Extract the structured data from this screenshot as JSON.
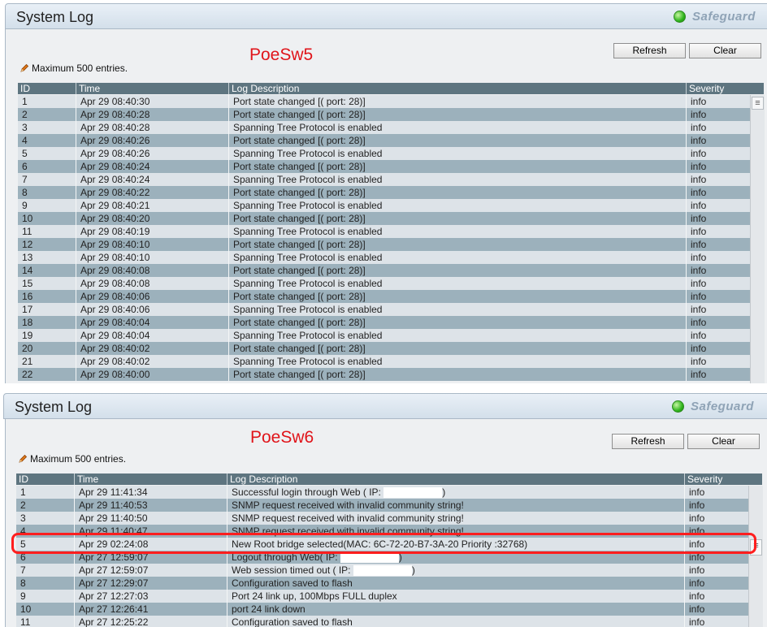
{
  "colors": {
    "header_bg": "#5e7580",
    "row_light": "#dde3e8",
    "row_dark": "#9cb1bc",
    "annotation_red": "#e0141a",
    "status_green": "#2fb51c"
  },
  "panels": [
    {
      "title": "System Log",
      "safeguard_label": "Safeguard",
      "switch_label": "PoeSw5",
      "max_note": "Maximum 500 entries.",
      "refresh_label": "Refresh",
      "clear_label": "Clear",
      "columns": [
        "ID",
        "Time",
        "Log Description",
        "Severity"
      ],
      "rows": [
        {
          "id": "1",
          "time": "Apr 29 08:40:30",
          "desc": "Port state changed [( port: 28)]",
          "severity": "info"
        },
        {
          "id": "2",
          "time": "Apr 29 08:40:28",
          "desc": "Port state changed [( port: 28)]",
          "severity": "info"
        },
        {
          "id": "3",
          "time": "Apr 29 08:40:28",
          "desc": "Spanning Tree Protocol is enabled",
          "severity": "info"
        },
        {
          "id": "4",
          "time": "Apr 29 08:40:26",
          "desc": "Port state changed [( port: 28)]",
          "severity": "info"
        },
        {
          "id": "5",
          "time": "Apr 29 08:40:26",
          "desc": "Spanning Tree Protocol is enabled",
          "severity": "info"
        },
        {
          "id": "6",
          "time": "Apr 29 08:40:24",
          "desc": "Port state changed [( port: 28)]",
          "severity": "info"
        },
        {
          "id": "7",
          "time": "Apr 29 08:40:24",
          "desc": "Spanning Tree Protocol is enabled",
          "severity": "info"
        },
        {
          "id": "8",
          "time": "Apr 29 08:40:22",
          "desc": "Port state changed [( port: 28)]",
          "severity": "info"
        },
        {
          "id": "9",
          "time": "Apr 29 08:40:21",
          "desc": "Spanning Tree Protocol is enabled",
          "severity": "info"
        },
        {
          "id": "10",
          "time": "Apr 29 08:40:20",
          "desc": "Port state changed [( port: 28)]",
          "severity": "info"
        },
        {
          "id": "11",
          "time": "Apr 29 08:40:19",
          "desc": "Spanning Tree Protocol is enabled",
          "severity": "info"
        },
        {
          "id": "12",
          "time": "Apr 29 08:40:10",
          "desc": "Port state changed [( port: 28)]",
          "severity": "info"
        },
        {
          "id": "13",
          "time": "Apr 29 08:40:10",
          "desc": "Spanning Tree Protocol is enabled",
          "severity": "info"
        },
        {
          "id": "14",
          "time": "Apr 29 08:40:08",
          "desc": "Port state changed [( port: 28)]",
          "severity": "info"
        },
        {
          "id": "15",
          "time": "Apr 29 08:40:08",
          "desc": "Spanning Tree Protocol is enabled",
          "severity": "info"
        },
        {
          "id": "16",
          "time": "Apr 29 08:40:06",
          "desc": "Port state changed [( port: 28)]",
          "severity": "info"
        },
        {
          "id": "17",
          "time": "Apr 29 08:40:06",
          "desc": "Spanning Tree Protocol is enabled",
          "severity": "info"
        },
        {
          "id": "18",
          "time": "Apr 29 08:40:04",
          "desc": "Port state changed [( port: 28)]",
          "severity": "info"
        },
        {
          "id": "19",
          "time": "Apr 29 08:40:04",
          "desc": "Spanning Tree Protocol is enabled",
          "severity": "info"
        },
        {
          "id": "20",
          "time": "Apr 29 08:40:02",
          "desc": "Port state changed [( port: 28)]",
          "severity": "info"
        },
        {
          "id": "21",
          "time": "Apr 29 08:40:02",
          "desc": "Spanning Tree Protocol is enabled",
          "severity": "info"
        },
        {
          "id": "22",
          "time": "Apr 29 08:40:00",
          "desc": "Port state changed [( port: 28)]",
          "severity": "info"
        }
      ]
    },
    {
      "title": "System Log",
      "safeguard_label": "Safeguard",
      "switch_label": "PoeSw6",
      "max_note": "Maximum 500 entries.",
      "refresh_label": "Refresh",
      "clear_label": "Clear",
      "columns": [
        "ID",
        "Time",
        "Log Description",
        "Severity"
      ],
      "rows": [
        {
          "id": "1",
          "time": "Apr 29 11:41:34",
          "desc": "Successful login through Web ( IP:",
          "desc_tail": ")",
          "redacted": true,
          "severity": "info"
        },
        {
          "id": "2",
          "time": "Apr 29 11:40:53",
          "desc": "SNMP request received with invalid community string!",
          "severity": "info"
        },
        {
          "id": "3",
          "time": "Apr 29 11:40:50",
          "desc": "SNMP request received with invalid community string!",
          "severity": "info"
        },
        {
          "id": "4",
          "time": "Apr 29 11:40:47",
          "desc": "SNMP request received with invalid community string!",
          "severity": "info"
        },
        {
          "id": "5",
          "time": "Apr 29 02:24:08",
          "desc": "New Root bridge selected(MAC: 6C-72-20-B7-3A-20 Priority :32768)",
          "severity": "info"
        },
        {
          "id": "6",
          "time": "Apr 27 12:59:07",
          "desc": "Logout through Web( IP:",
          "desc_tail": ")",
          "redacted": true,
          "severity": "info"
        },
        {
          "id": "7",
          "time": "Apr 27 12:59:07",
          "desc": "Web session timed out ( IP:",
          "desc_tail": ")",
          "redacted": true,
          "severity": "info"
        },
        {
          "id": "8",
          "time": "Apr 27 12:29:07",
          "desc": "Configuration saved to flash",
          "severity": "info"
        },
        {
          "id": "9",
          "time": "Apr 27 12:27:03",
          "desc": "Port 24 link up, 100Mbps FULL duplex",
          "severity": "info"
        },
        {
          "id": "10",
          "time": "Apr 27 12:26:41",
          "desc": "port 24 link down",
          "severity": "info"
        },
        {
          "id": "11",
          "time": "Apr 27 12:25:22",
          "desc": "Configuration saved to flash",
          "severity": "info"
        }
      ]
    }
  ]
}
